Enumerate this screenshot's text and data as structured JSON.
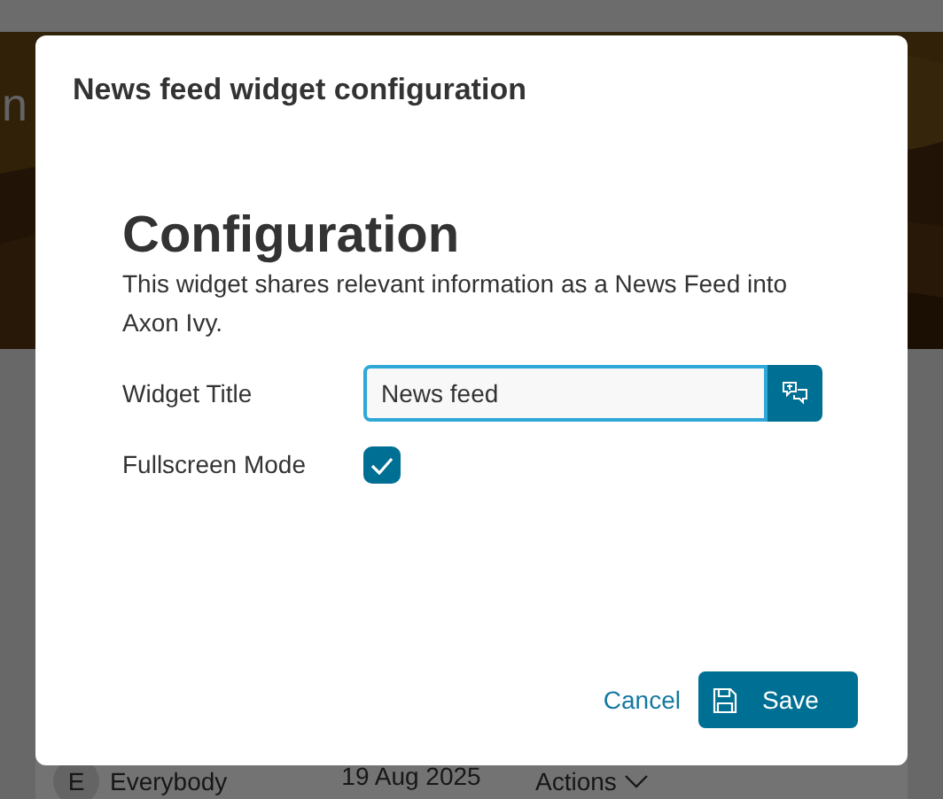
{
  "background": {
    "banner_title": "n",
    "row": {
      "avatar": "E",
      "name": "Everybody",
      "date": "19 Aug 2025",
      "actions": "Actions"
    }
  },
  "dialog": {
    "title": "News feed widget configuration",
    "heading": "Configuration",
    "description": "This widget shares relevant information as a News Feed into Axon Ivy.",
    "fields": [
      {
        "kind": "text",
        "label": "Widget Title",
        "value": "News feed",
        "focused": true
      },
      {
        "kind": "checkbox",
        "label": "Fullscreen Mode",
        "checked": true
      }
    ],
    "buttons": [
      {
        "kind": "link",
        "label": "Cancel"
      },
      {
        "kind": "primary",
        "label": "Save"
      }
    ]
  }
}
